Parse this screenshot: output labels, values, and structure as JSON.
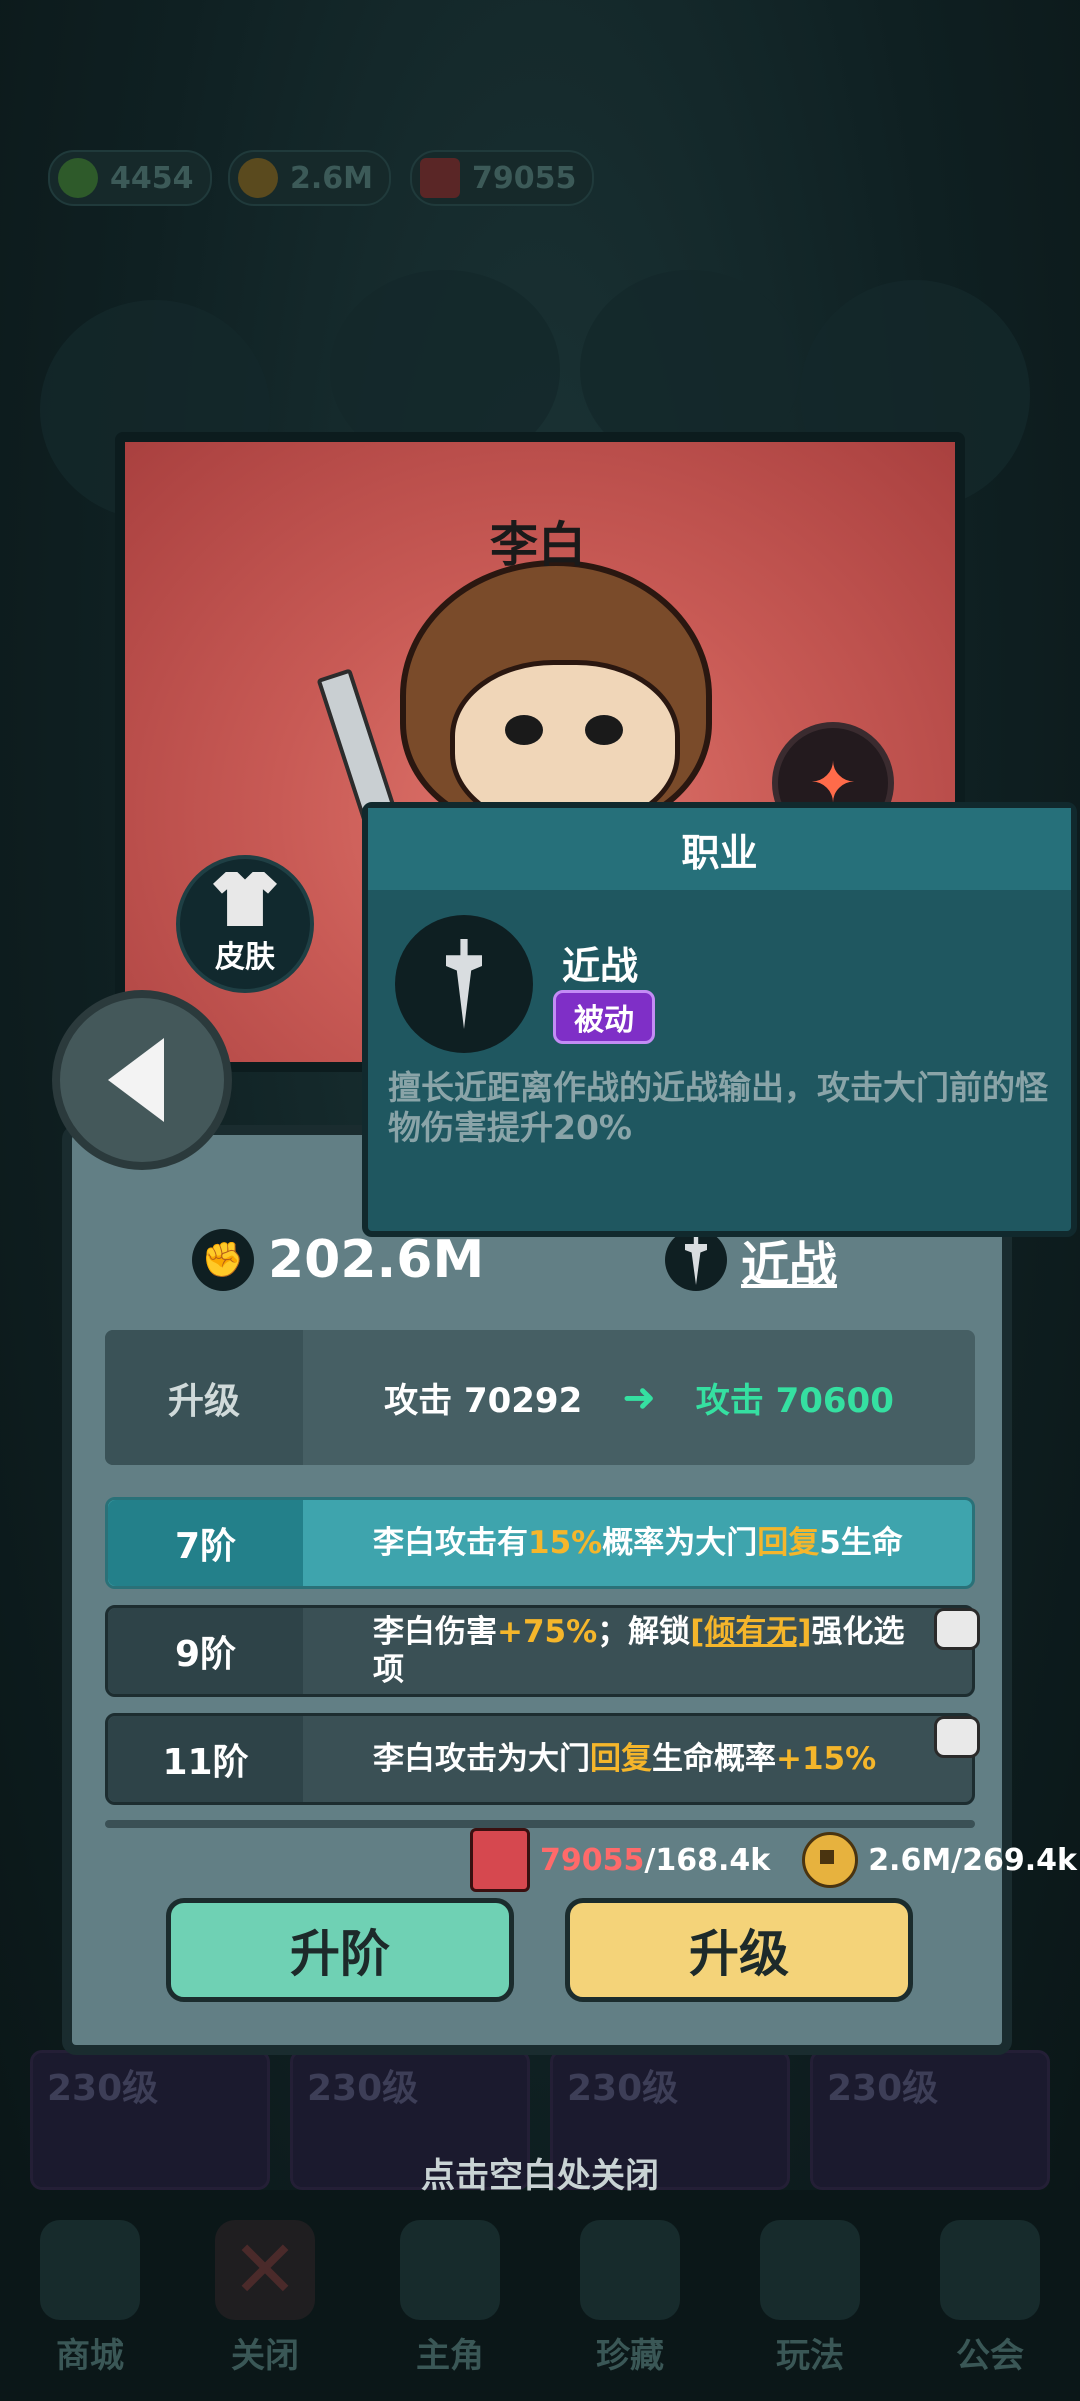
{
  "resources": [
    {
      "icon": "green-gem-icon",
      "value": "4454"
    },
    {
      "icon": "gold-coin-icon",
      "value": "2.6M"
    },
    {
      "icon": "red-book-icon",
      "value": "79055"
    }
  ],
  "hero": {
    "name": "李白",
    "skin_label": "皮肤"
  },
  "popup": {
    "header": "职业",
    "class_name": "近战",
    "tag": "被动",
    "description": "擅长近距离作战的近战输出，攻击大门前的怪物伤害提升20%"
  },
  "stats": {
    "power": "202.6M",
    "class": "近战"
  },
  "upgrade": {
    "label": "升级",
    "current": "攻击 70292",
    "next": "攻击 70600"
  },
  "tiers": [
    {
      "tier": "7阶",
      "active": true,
      "parts": [
        {
          "t": "李白攻击有"
        },
        {
          "t": "15%",
          "h": 1
        },
        {
          "t": "概率为大门"
        },
        {
          "t": "回复",
          "h": 1
        },
        {
          "t": "5生命"
        }
      ]
    },
    {
      "tier": "9阶",
      "active": false,
      "locked": true,
      "parts": [
        {
          "t": "李白伤害"
        },
        {
          "t": "+75%",
          "h": 1
        },
        {
          "t": "；解锁"
        },
        {
          "t": "[倾有无]",
          "h": 2
        },
        {
          "t": "强化选项"
        }
      ]
    },
    {
      "tier": "11阶",
      "active": false,
      "locked": true,
      "parts": [
        {
          "t": "李白攻击为大门"
        },
        {
          "t": "回复",
          "h": 1
        },
        {
          "t": "生命概率"
        },
        {
          "t": "+15%",
          "h": 1
        }
      ]
    }
  ],
  "costs": {
    "books_have": "79055",
    "books_need": "/168.4k",
    "coins": "2.6M/269.4k"
  },
  "buttons": {
    "advance": "升阶",
    "upgrade": "升级"
  },
  "close_hint": "点击空白处关闭",
  "level_cards": [
    "230级",
    "230级",
    "230级",
    "230级"
  ],
  "nav": [
    "商城",
    "关闭",
    "主角",
    "珍藏",
    "玩法",
    "公会"
  ]
}
